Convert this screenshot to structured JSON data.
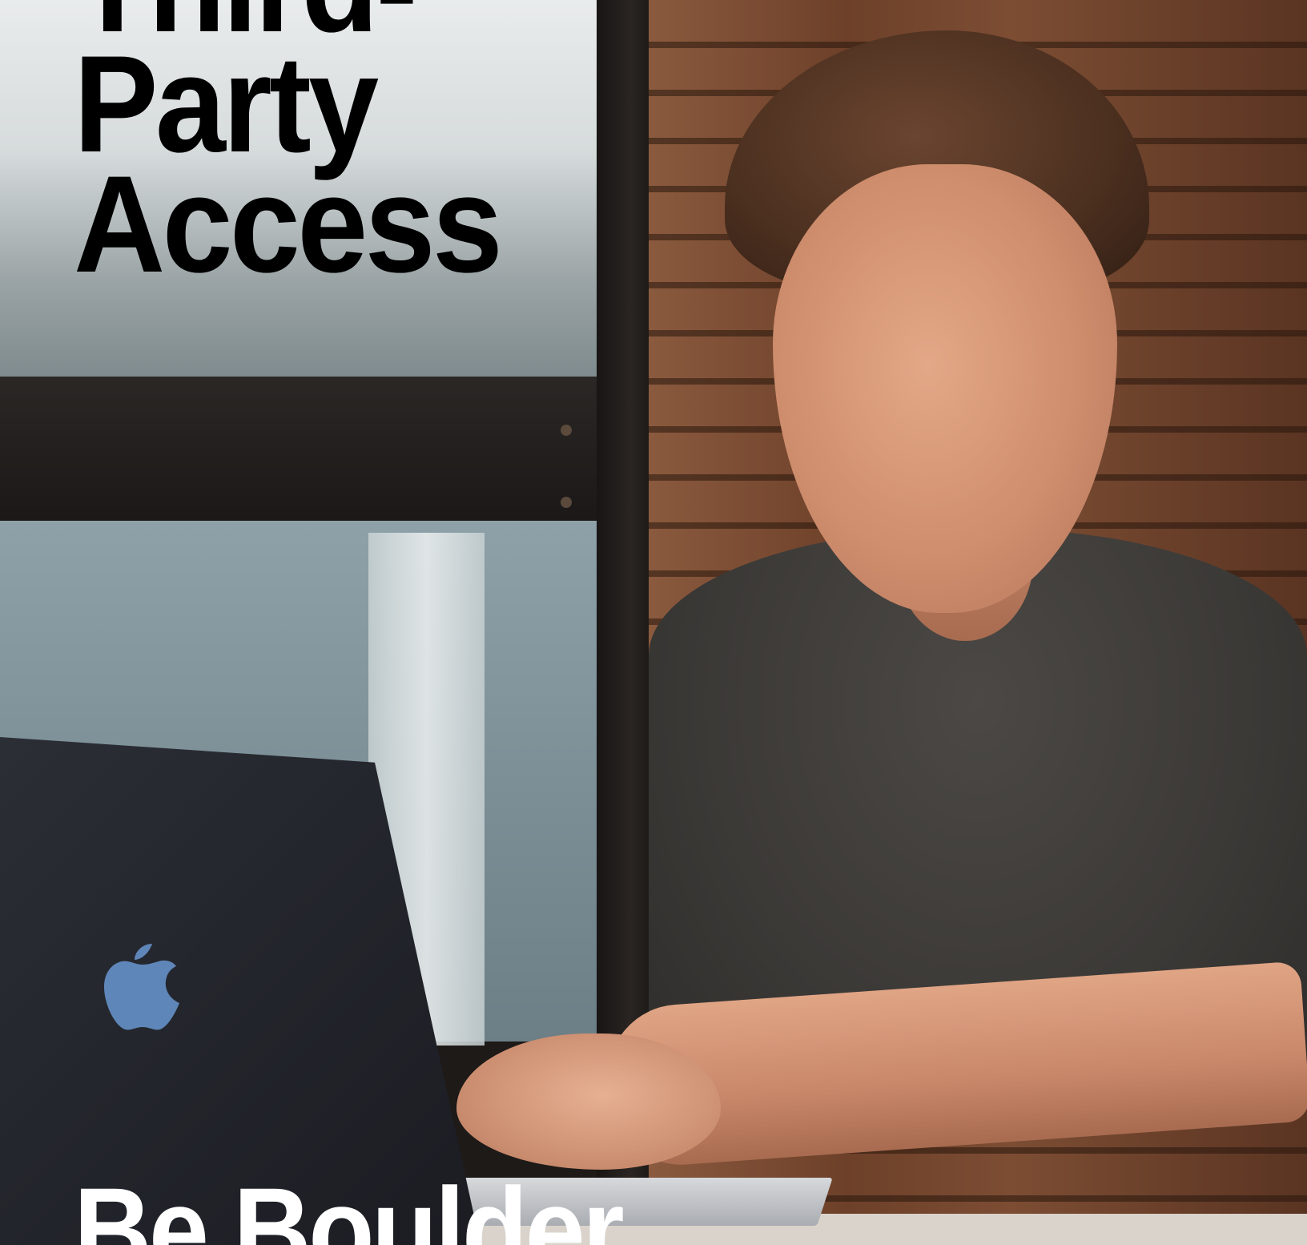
{
  "title": {
    "line1": "Third-",
    "line2": "Party",
    "line3": "Access"
  },
  "brand": {
    "text": "Be Boulder"
  },
  "colors": {
    "title_text": "#000000",
    "brand_text": "#ffffff",
    "apple_logo": "#5f86b8"
  },
  "icons": {
    "laptop_logo": "apple-icon"
  }
}
